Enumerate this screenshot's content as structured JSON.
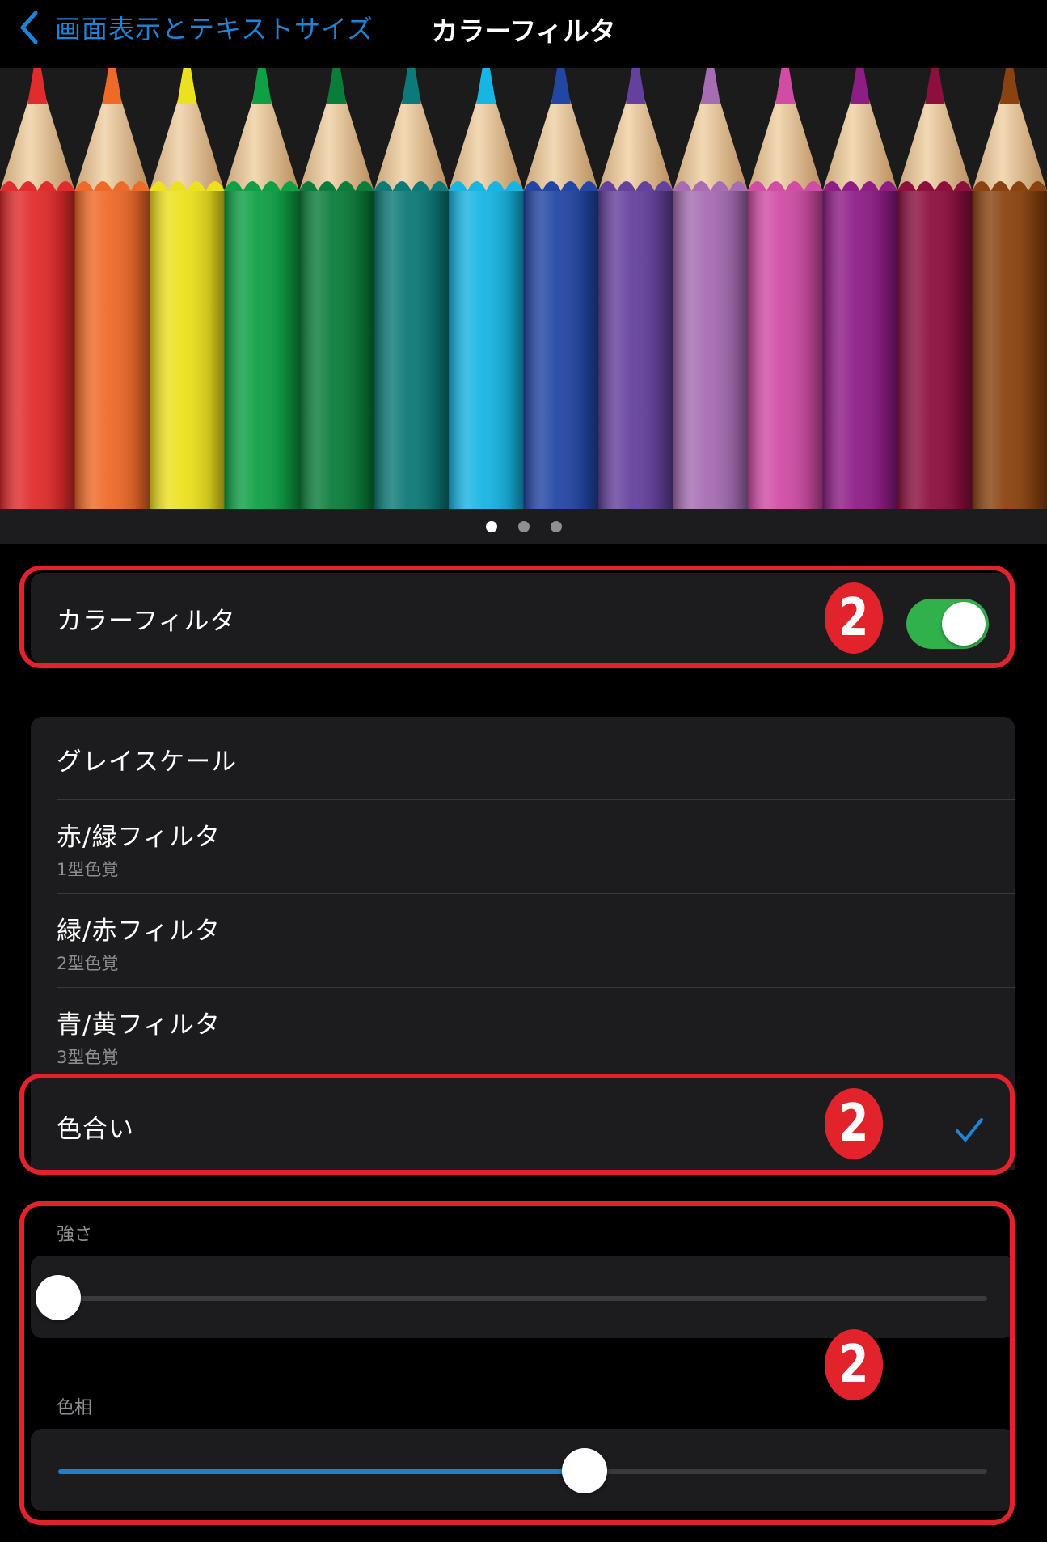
{
  "nav": {
    "back_label": "画面表示とテキストサイズ",
    "title": "カラーフィルタ"
  },
  "banner": {
    "pencil_colors": [
      "#e02c2c",
      "#ee6a28",
      "#ece11e",
      "#0fa046",
      "#0b7d3a",
      "#0c7a78",
      "#17b5e3",
      "#2346a4",
      "#64419d",
      "#a66db3",
      "#d04ca5",
      "#8e1d86",
      "#8c0f3e",
      "#8a4310"
    ],
    "page_count": 3,
    "active_page": 0
  },
  "color_filter_toggle": {
    "label": "カラーフィルタ",
    "on": true,
    "on_color": "#30b14c"
  },
  "filters": {
    "options": [
      {
        "label": "グレイスケール",
        "sublabel": ""
      },
      {
        "label": "赤/緑フィルタ",
        "sublabel": "1型色覚"
      },
      {
        "label": "緑/赤フィルタ",
        "sublabel": "2型色覚"
      },
      {
        "label": "青/黄フィルタ",
        "sublabel": "3型色覚"
      }
    ],
    "selected": {
      "label": "色合い"
    }
  },
  "intensity": {
    "label": "強さ",
    "value": 0.0
  },
  "hue": {
    "label": "色相",
    "value": 0.567
  },
  "annotation": {
    "badge_text": "2",
    "color": "#e2232b"
  },
  "accent_color": "#1f83d6"
}
